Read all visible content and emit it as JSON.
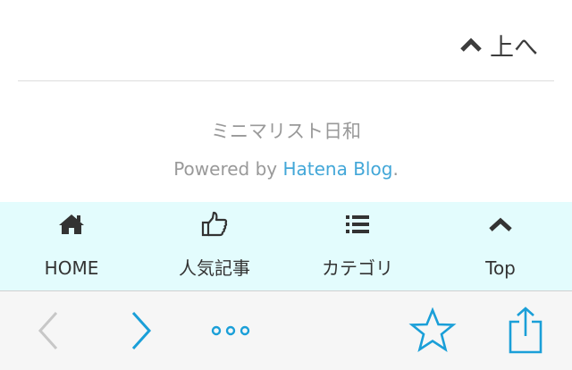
{
  "to_top": {
    "label": "上へ",
    "icon": "chevron-up-icon"
  },
  "footer": {
    "site_name": "ミニマリスト日和",
    "powered_prefix": "Powered by ",
    "powered_link": "Hatena Blog",
    "powered_suffix": "."
  },
  "bottom_nav": {
    "background": "#e3fcfd",
    "items": [
      {
        "label": "HOME",
        "icon": "home-icon"
      },
      {
        "label": "人気記事",
        "icon": "thumbs-up-icon"
      },
      {
        "label": "カテゴリ",
        "icon": "list-icon"
      },
      {
        "label": "Top",
        "icon": "chevron-up-icon"
      }
    ]
  },
  "browser_toolbar": {
    "accent_color": "#1a9fd8",
    "disabled_color": "#c7c7c7",
    "buttons": [
      {
        "name": "back",
        "icon": "chevron-left-icon",
        "enabled": false
      },
      {
        "name": "forward",
        "icon": "chevron-right-icon",
        "enabled": true
      },
      {
        "name": "more",
        "icon": "more-icon",
        "enabled": true
      },
      {
        "name": "bookmark",
        "icon": "star-icon",
        "enabled": true
      },
      {
        "name": "share",
        "icon": "share-icon",
        "enabled": true
      }
    ]
  }
}
